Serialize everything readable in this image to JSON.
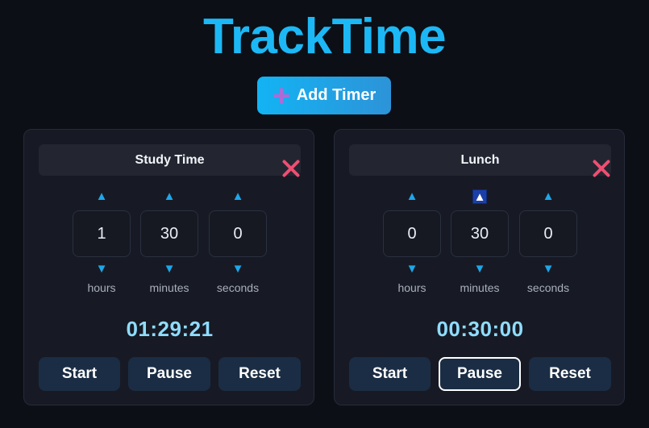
{
  "app": {
    "title": "TrackTime"
  },
  "toolbar": {
    "add_label": "Add Timer",
    "add_icon": "plus-icon"
  },
  "colors": {
    "background": "#0c0f16",
    "accent": "#1cb8f5",
    "delete": "#ef4e72",
    "display": "#8fdcff",
    "button": "#1b2d44"
  },
  "timers": [
    {
      "name": "Study Time",
      "hours": "1",
      "minutes": "30",
      "seconds": "0",
      "units": {
        "hours": "hours",
        "minutes": "minutes",
        "seconds": "seconds"
      },
      "display": "01:29:21",
      "buttons": {
        "start": "Start",
        "pause": "Pause",
        "reset": "Reset"
      }
    },
    {
      "name": "Lunch",
      "hours": "0",
      "minutes": "30",
      "seconds": "0",
      "units": {
        "hours": "hours",
        "minutes": "minutes",
        "seconds": "seconds"
      },
      "display": "00:30:00",
      "buttons": {
        "start": "Start",
        "pause": "Pause",
        "reset": "Reset"
      }
    }
  ],
  "arrows": {
    "up": "▲",
    "down": "▼"
  }
}
